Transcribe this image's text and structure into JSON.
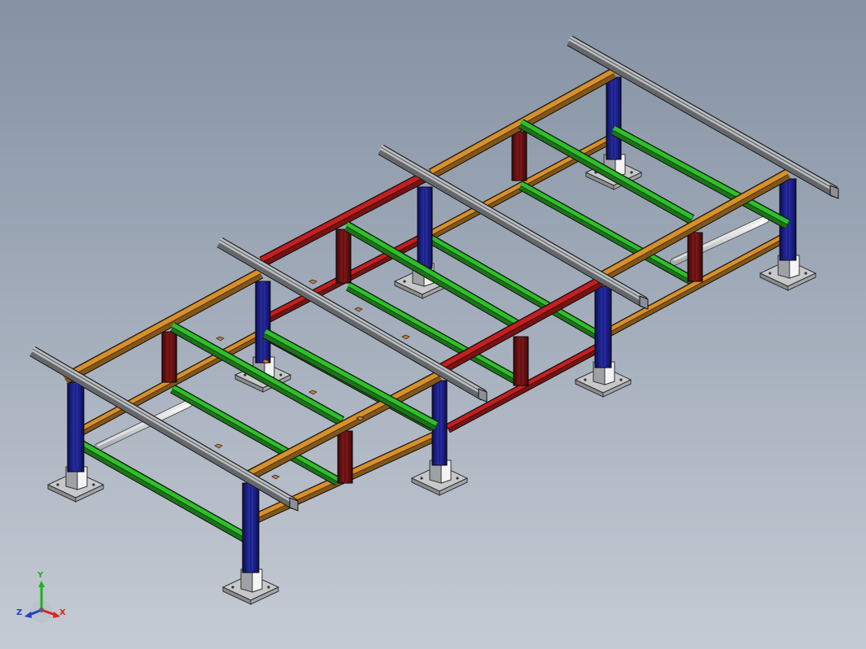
{
  "viewport": {
    "background_top": "#8592a3",
    "background_bottom": "#c5cbd4"
  },
  "colors": {
    "gray_rail": "#b9bcc0",
    "orange_beam": "#d8902a",
    "red_beam": "#c42020",
    "green_beam": "#2fbf2a",
    "blue_post": "#1a1e8c",
    "dark_red_post": "#6e1414",
    "base_plate": "#c6c8ca",
    "copper_tab": "#c87a3a",
    "silver_rod": "#e4e6e8"
  },
  "triad": {
    "x_label": "X",
    "y_label": "Y",
    "z_label": "Z",
    "x_color": "#e02020",
    "y_color": "#20b020",
    "z_color": "#2040d0"
  }
}
